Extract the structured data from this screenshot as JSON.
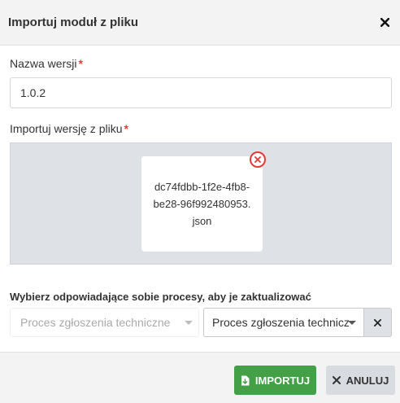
{
  "dialog": {
    "title": "Importuj moduł z pliku"
  },
  "form": {
    "version_label": "Nazwa wersji",
    "version_value": "1.0.2",
    "file_label": "Importuj wersję z pliku",
    "required_mark": "*",
    "file_name": "dc74fdbb-1f2e-4fb8-be28-96f992480953.json",
    "process_label": "Wybierz odpowiadające sobie procesy, aby je zaktualizować",
    "source_process": "Proces zgłoszenia technicznego",
    "target_process": "Proces zgłoszenia techniczn"
  },
  "footer": {
    "import_label": "IMPORTUJ",
    "cancel_label": "ANULUJ"
  },
  "colors": {
    "import_button": "#43a047",
    "required": "#e53935",
    "dropzone": "#dee1e6"
  },
  "icons": {
    "close": "close-icon",
    "remove_file": "remove-file-icon",
    "import": "file-import-icon",
    "cancel": "cancel-x-icon",
    "dropdown": "chevron-down-icon"
  }
}
